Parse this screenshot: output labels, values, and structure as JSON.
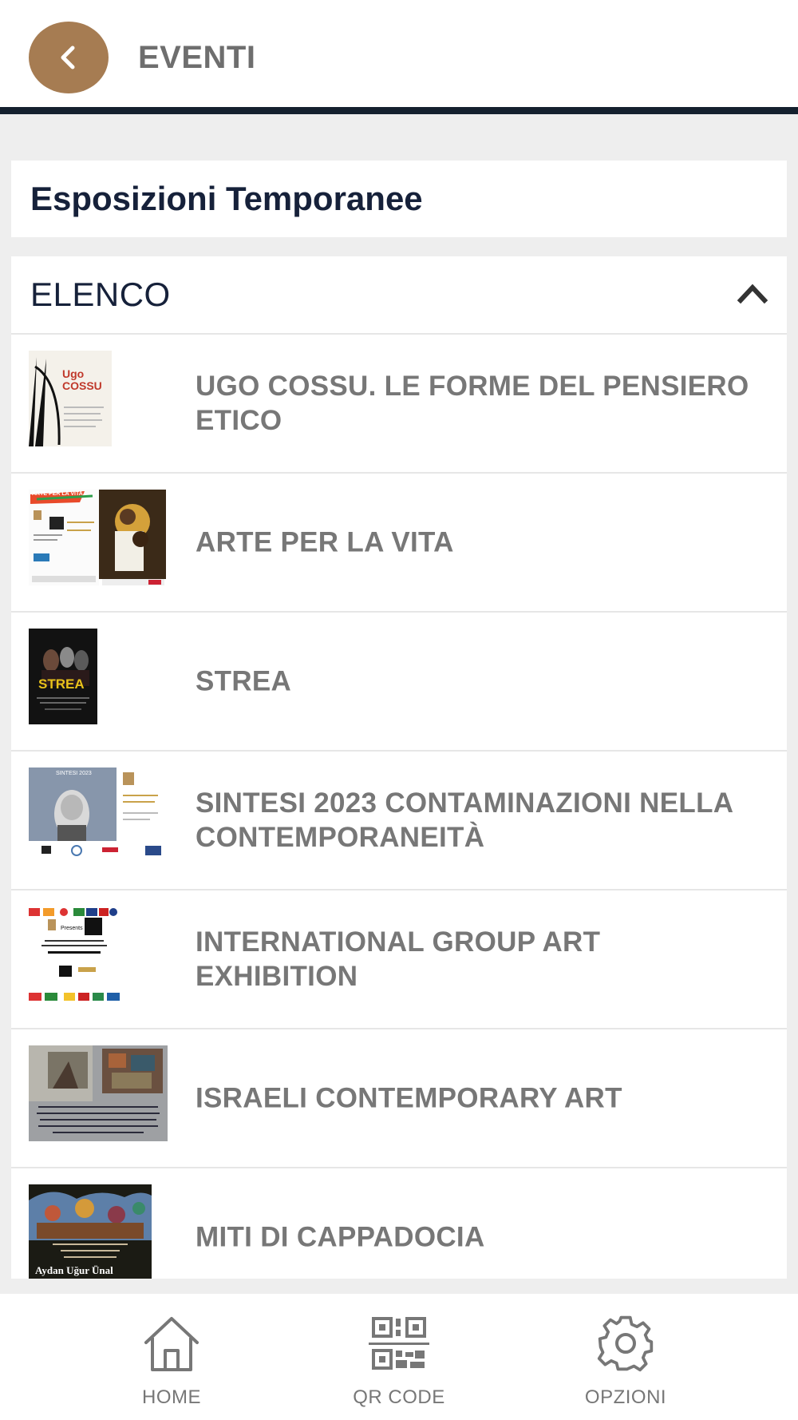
{
  "header": {
    "title": "EVENTI",
    "back_icon": "chevron-left-icon",
    "accent_color": "#a67c52",
    "bar_color": "#14202e"
  },
  "section": {
    "title": "Esposizioni Temporanee"
  },
  "list": {
    "title": "ELENCO",
    "toggle_icon": "chevron-up-icon",
    "items": [
      {
        "title": "UGO COSSU. LE FORME DEL PENSIERO ETICO",
        "thumb_text": "Ugo COSSU"
      },
      {
        "title": "ARTE PER LA VITA",
        "thumb_text": "ARTE PER LA VITA"
      },
      {
        "title": "STREA",
        "thumb_text": "STREA"
      },
      {
        "title": "SINTESI 2023 CONTAMINAZIONI NELLA CONTEMPORANEITÀ",
        "thumb_text": "SINTESI 2023"
      },
      {
        "title": "INTERNATIONAL GROUP ART EXHIBITION",
        "thumb_text": "Presents"
      },
      {
        "title": "ISRAELI CONTEMPORARY ART",
        "thumb_text": ""
      },
      {
        "title": "MITI DI CAPPADOCIA",
        "thumb_text": "Aydan Uğur Ünal"
      }
    ]
  },
  "bottom_nav": [
    {
      "label": "HOME",
      "icon": "home-icon"
    },
    {
      "label": "QR CODE",
      "icon": "qr-code-icon"
    },
    {
      "label": "OPZIONI",
      "icon": "gear-icon"
    }
  ]
}
